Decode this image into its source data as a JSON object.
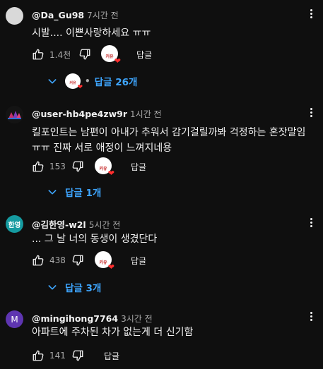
{
  "creator_badge_text": "커유",
  "comments": [
    {
      "author": "@Da_Gu98",
      "time": "7시간 전",
      "text": "시발.... 이쁜사랑하세요 ㅠㅠ",
      "likes": "1.4천",
      "reply_label": "답글",
      "replies_label": "답글 26개",
      "has_creator_reply": true
    },
    {
      "author": "@user-hb4pe4zw9r",
      "time": "1시간 전",
      "text": "킬포인트는 남편이 아내가 추워서 감기걸릴까봐 걱정하는  혼잣말임 ㅠㅠ 진짜 서로 애정이 느껴지네용",
      "likes": "153",
      "reply_label": "답글",
      "replies_label": "답글 1개"
    },
    {
      "author": "@김한영-w2l",
      "time": "5시간 전",
      "avatar_text": "한영",
      "text": "... 그 날 너의 동생이 생겼단다",
      "likes": "438",
      "reply_label": "답글",
      "replies_label": "답글 3개"
    },
    {
      "author": "@mingihong7764",
      "time": "3시간 전",
      "avatar_text": "M",
      "text": "아파트에 주차된 차가 없는게 더 신기함",
      "likes": "141",
      "reply_label": "답글"
    }
  ],
  "colors": {
    "background": "#0f0f0f",
    "link": "#3ea6ff",
    "muted": "#aaaaaa",
    "heart": "#ff2e2e"
  },
  "icons": [
    "thumb-up-icon",
    "thumb-down-icon",
    "more-vert-icon",
    "chevron-down-icon",
    "heart-icon"
  ]
}
